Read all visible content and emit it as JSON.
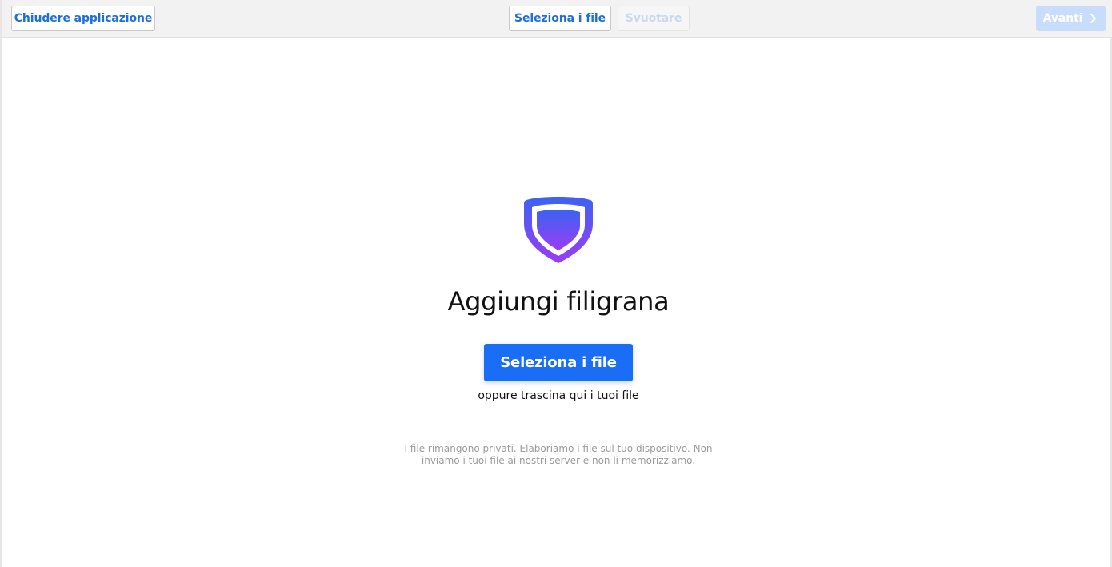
{
  "toolbar": {
    "close_label": "Chiudere applicazione",
    "select_label": "Seleziona i file",
    "empty_label": "Svuotare",
    "next_label": "Avanti"
  },
  "main": {
    "title": "Aggiungi filigrana",
    "select_button_label": "Seleziona i file",
    "drop_hint": "oppure trascina qui i tuoi file",
    "privacy_line1": "I file rimangono privati. Elaboriamo i file sul tuo dispositivo. Non",
    "privacy_line2": "inviamo i tuoi file ai nostri server e non li memorizziamo."
  },
  "icons": {
    "logo": "shield-icon",
    "next": "chevron-right-icon"
  },
  "colors": {
    "primary": "#1a6df5",
    "link_text": "#1f6fd6",
    "disabled_primary": "#c8dcfb",
    "logo_gradient_start": "#3b63f2",
    "logo_gradient_end": "#9b3cf3"
  },
  "state": {
    "empty_disabled": true,
    "next_disabled": true
  }
}
